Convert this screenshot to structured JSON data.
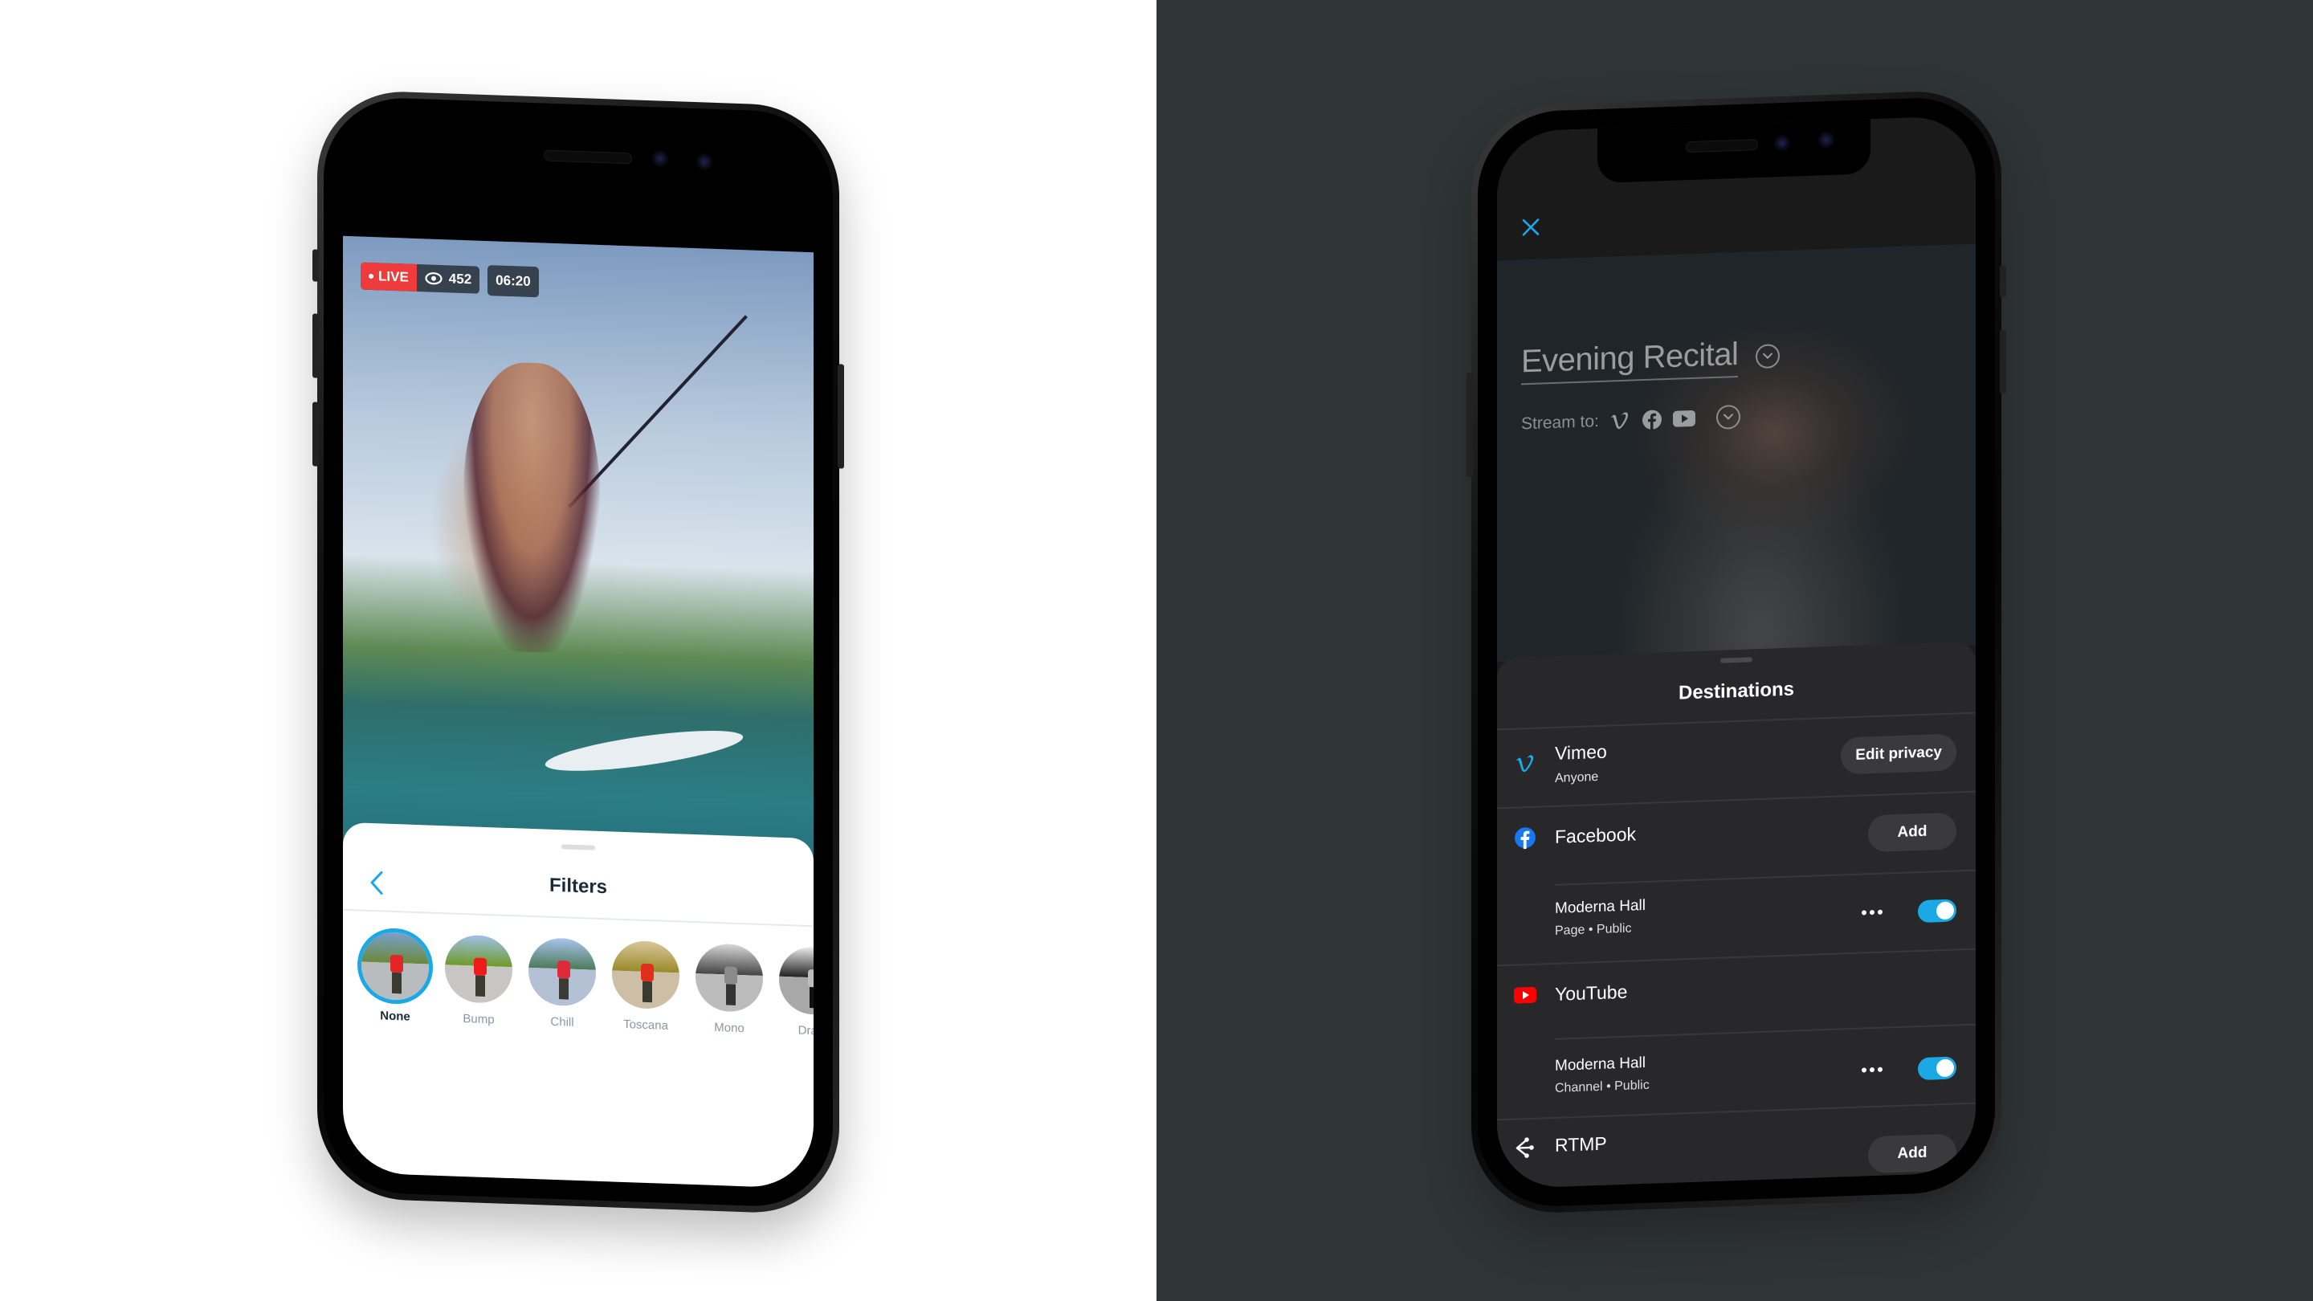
{
  "left_phone": {
    "live_badge": "LIVE",
    "viewer_count": "452",
    "viewer_icon": "eye-icon",
    "elapsed_time": "06:20",
    "filters_sheet": {
      "title": "Filters",
      "back_icon": "chevron-left-icon",
      "selected_filter": "None",
      "filters": [
        {
          "label": "None"
        },
        {
          "label": "Bump"
        },
        {
          "label": "Chill"
        },
        {
          "label": "Toscana"
        },
        {
          "label": "Mono"
        },
        {
          "label": "Dram"
        }
      ]
    }
  },
  "right_phone": {
    "close_icon": "close-icon",
    "event_title": "Evening Recital",
    "stream_to_label": "Stream to:",
    "stream_icons": [
      "vimeo-icon",
      "facebook-icon",
      "youtube-icon"
    ],
    "destinations": {
      "title": "Destinations",
      "vimeo": {
        "name": "Vimeo",
        "privacy": "Anyone",
        "button": "Edit privacy"
      },
      "facebook": {
        "name": "Facebook",
        "button": "Add",
        "account": {
          "name": "Moderna Hall",
          "type": "Page",
          "privacy": "Public",
          "enabled": true
        }
      },
      "youtube": {
        "name": "YouTube",
        "account": {
          "name": "Moderna Hall",
          "type": "Channel",
          "privacy": "Public",
          "enabled": true
        }
      },
      "rtmp": {
        "name": "RTMP",
        "button": "Add"
      },
      "separator": "•"
    }
  },
  "colors": {
    "accent": "#1ba9e6",
    "live_red": "#ee3b3b",
    "youtube_red": "#ff0000",
    "facebook_blue": "#1877f2",
    "right_background": "#2f3437",
    "sheet_dark": "#28282b"
  }
}
